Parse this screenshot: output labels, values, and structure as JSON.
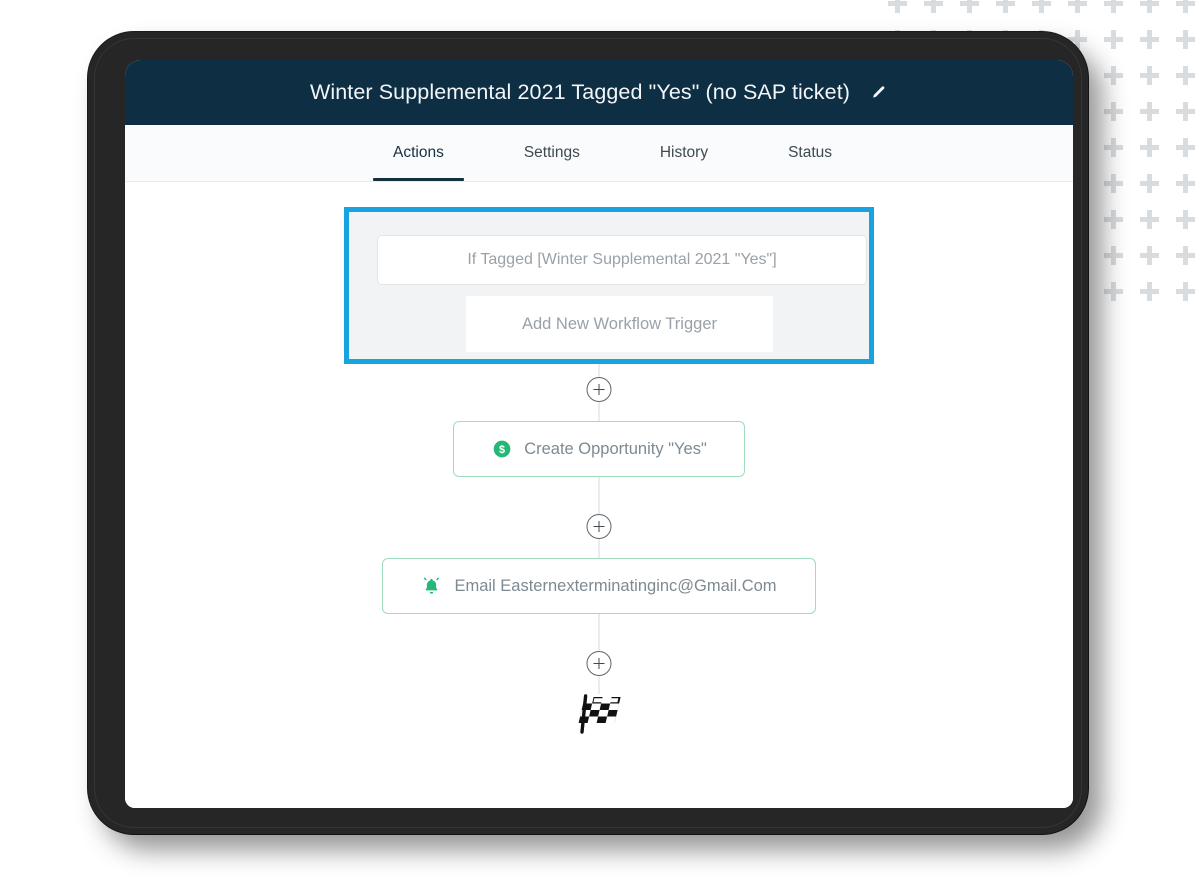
{
  "colors": {
    "header_bg": "#0e2e44",
    "accent_blue": "#17a3e0",
    "node_green_border": "#9ddcbc",
    "node_green_icon": "#23b877",
    "tab_active_underline": "#13303f",
    "device_bezel": "#262626",
    "panel_bg": "#f2f3f5",
    "muted_text": "#9aa1a8",
    "connector_line": "#d6d9dc",
    "pattern_dot": "#d9dcdf"
  },
  "header": {
    "title": "Winter Supplemental 2021 Tagged \"Yes\" (no SAP ticket)",
    "edit_icon": "pencil-icon"
  },
  "tabs": [
    {
      "label": "Actions",
      "active": true
    },
    {
      "label": "Settings",
      "active": false
    },
    {
      "label": "History",
      "active": false
    },
    {
      "label": "Status",
      "active": false
    }
  ],
  "flow": {
    "trigger_group": {
      "highlighted": true,
      "trigger_label": "If Tagged [Winter Supplemental 2021 \"Yes\"]",
      "add_trigger_label": "Add New Workflow Trigger"
    },
    "add_step_icon": "plus-circle-icon",
    "actions": [
      {
        "label": "Create Opportunity \"Yes\"",
        "icon": "dollar-circle-icon"
      },
      {
        "label": "Email Easternexterminatinginc@Gmail.Com",
        "icon": "bell-icon"
      }
    ],
    "end_icon": "checkered-flag-icon"
  },
  "decoration": {
    "pattern_icon": "plus-grid-pattern",
    "columns": 9,
    "rows": 9
  }
}
